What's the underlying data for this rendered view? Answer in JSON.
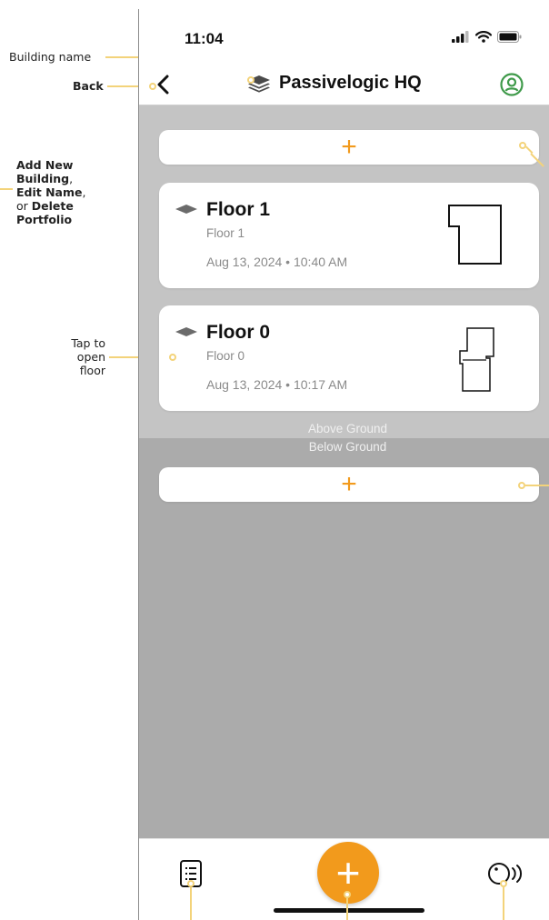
{
  "annotations": {
    "building_name": "Building name",
    "back": "Back",
    "add_new_line1": "Add New",
    "add_new_line2": "Building",
    "add_new_sep1": ",",
    "edit_name": "Edit Name",
    "edit_sep": ",",
    "or_text": "or ",
    "delete_text": "Delete",
    "portfolio": "Portfolio",
    "tap_line1": "Tap to",
    "tap_line2": "open",
    "tap_line3": "floor"
  },
  "status_bar": {
    "time": "11:04"
  },
  "header": {
    "building_name": "Passivelogic HQ"
  },
  "add_above": {
    "label": "+"
  },
  "floors": [
    {
      "name": "Floor 1",
      "subtitle": "Floor 1",
      "date": "Aug 13, 2024 • 10:40 AM"
    },
    {
      "name": "Floor 0",
      "subtitle": "Floor 0",
      "date": "Aug 13, 2024 • 10:17 AM"
    }
  ],
  "zones": {
    "above": "Above Ground",
    "below": "Below Ground"
  },
  "add_below": {
    "label": "+"
  },
  "tabbar": {
    "fab_label": "+"
  },
  "colors": {
    "accent": "#f29a1c",
    "annotation_line": "#f3d37a",
    "canvas_gray": "#ababab",
    "above_zone_gray": "#c4c4c4"
  },
  "icons": [
    "back-chevron-icon",
    "layers-icon",
    "profile-icon",
    "signal-icon",
    "wifi-icon",
    "battery-icon",
    "floor-diamond-icon",
    "floorplan-icon",
    "list-icon",
    "radar-icon"
  ]
}
